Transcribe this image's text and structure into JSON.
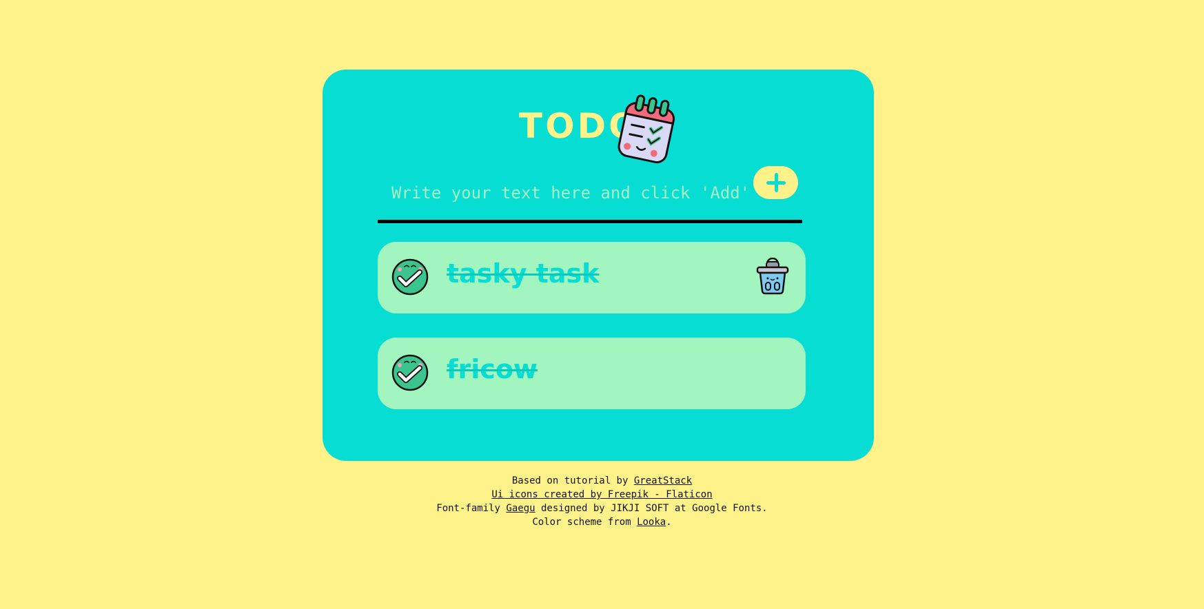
{
  "app": {
    "title": "TODO"
  },
  "input": {
    "placeholder": "Write your text here and click 'Add'",
    "value": ""
  },
  "tasks": [
    {
      "label": "tasky task",
      "completed": true
    },
    {
      "label": "fricow",
      "completed": true
    }
  ],
  "footer": {
    "line1_prefix": "Based on tutorial by ",
    "line1_link": "GreatStack",
    "line2_link": "Ui icons created by Freepik - Flaticon",
    "line3_prefix": "Font-family ",
    "line3_link": "Gaegu",
    "line3_suffix": " designed by JIKJI SOFT at Google Fonts.",
    "line4_prefix": "Color scheme from ",
    "line4_link": "Looka",
    "line4_suffix": "."
  },
  "colors": {
    "background": "#fff28a",
    "card": "#08ddd3",
    "task_bg": "#a3f5bf",
    "placeholder": "#a8f0c3",
    "accent_pink": "#f06b7d"
  },
  "icons": {
    "title": "calendar-checklist-icon",
    "add": "plus-icon",
    "check": "checked-circle-icon",
    "delete": "trash-basket-icon"
  }
}
